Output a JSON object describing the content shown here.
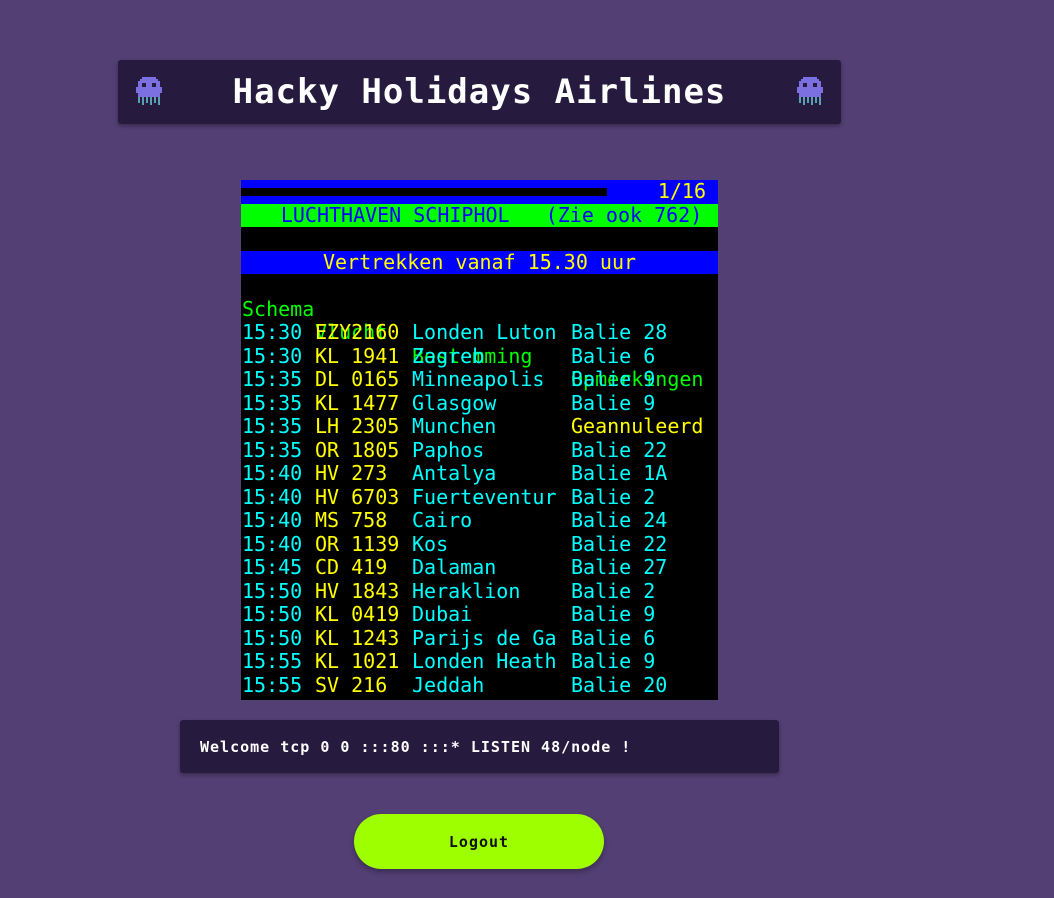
{
  "header": {
    "title": "Hacky Holidays Airlines",
    "left_icon": "alien-icon",
    "right_icon": "alien-icon"
  },
  "teletext": {
    "page_number": "1/16",
    "station": "  LUCHTHAVEN SCHIPHOL   (Zie ook 762)",
    "subtitle": "Vertrekken vanaf 15.30 uur",
    "columns": [
      "Schema",
      "Vlucht",
      "Bestemming",
      "Opmerkingen"
    ],
    "flights": [
      {
        "time": "15:30",
        "flight": "EZY2160",
        "destination": "Londen Luton",
        "remark": "Balie 28"
      },
      {
        "time": "15:30",
        "flight": "KL 1941",
        "destination": "Zagreb",
        "remark": "Balie 6"
      },
      {
        "time": "15:35",
        "flight": "DL 0165",
        "destination": "Minneapolis",
        "remark": "Balie 9"
      },
      {
        "time": "15:35",
        "flight": "KL 1477",
        "destination": "Glasgow",
        "remark": "Balie 9"
      },
      {
        "time": "15:35",
        "flight": "LH 2305",
        "destination": "Munchen",
        "remark": "Geannuleerd"
      },
      {
        "time": "15:35",
        "flight": "OR 1805",
        "destination": "Paphos",
        "remark": "Balie 22"
      },
      {
        "time": "15:40",
        "flight": "HV 273",
        "destination": "Antalya",
        "remark": "Balie 1A"
      },
      {
        "time": "15:40",
        "flight": "HV 6703",
        "destination": "Fuerteventur",
        "remark": "Balie 2"
      },
      {
        "time": "15:40",
        "flight": "MS 758",
        "destination": "Cairo",
        "remark": "Balie 24"
      },
      {
        "time": "15:40",
        "flight": "OR 1139",
        "destination": "Kos",
        "remark": "Balie 22"
      },
      {
        "time": "15:45",
        "flight": "CD 419",
        "destination": "Dalaman",
        "remark": "Balie 27"
      },
      {
        "time": "15:50",
        "flight": "HV 1843",
        "destination": "Heraklion",
        "remark": "Balie 2"
      },
      {
        "time": "15:50",
        "flight": "KL 0419",
        "destination": "Dubai",
        "remark": "Balie 9"
      },
      {
        "time": "15:50",
        "flight": "KL 1243",
        "destination": "Parijs de Ga",
        "remark": "Balie 6"
      },
      {
        "time": "15:55",
        "flight": "KL 1021",
        "destination": "Londen Heath",
        "remark": "Balie 9"
      },
      {
        "time": "15:55",
        "flight": "SV 216",
        "destination": "Jeddah",
        "remark": "Balie 20"
      }
    ],
    "colors": {
      "blue": "#0000ff",
      "green": "#00ff00",
      "yellow": "#ffff00",
      "cyan": "#00ffff",
      "black": "#000000"
    }
  },
  "welcome": {
    "text": "Welcome tcp 0 0 :::80 :::* LISTEN 48/node !"
  },
  "logout": {
    "label": "Logout",
    "color": "#9dff00"
  },
  "theme": {
    "background": "#533f74",
    "panel": "#261a3e"
  }
}
